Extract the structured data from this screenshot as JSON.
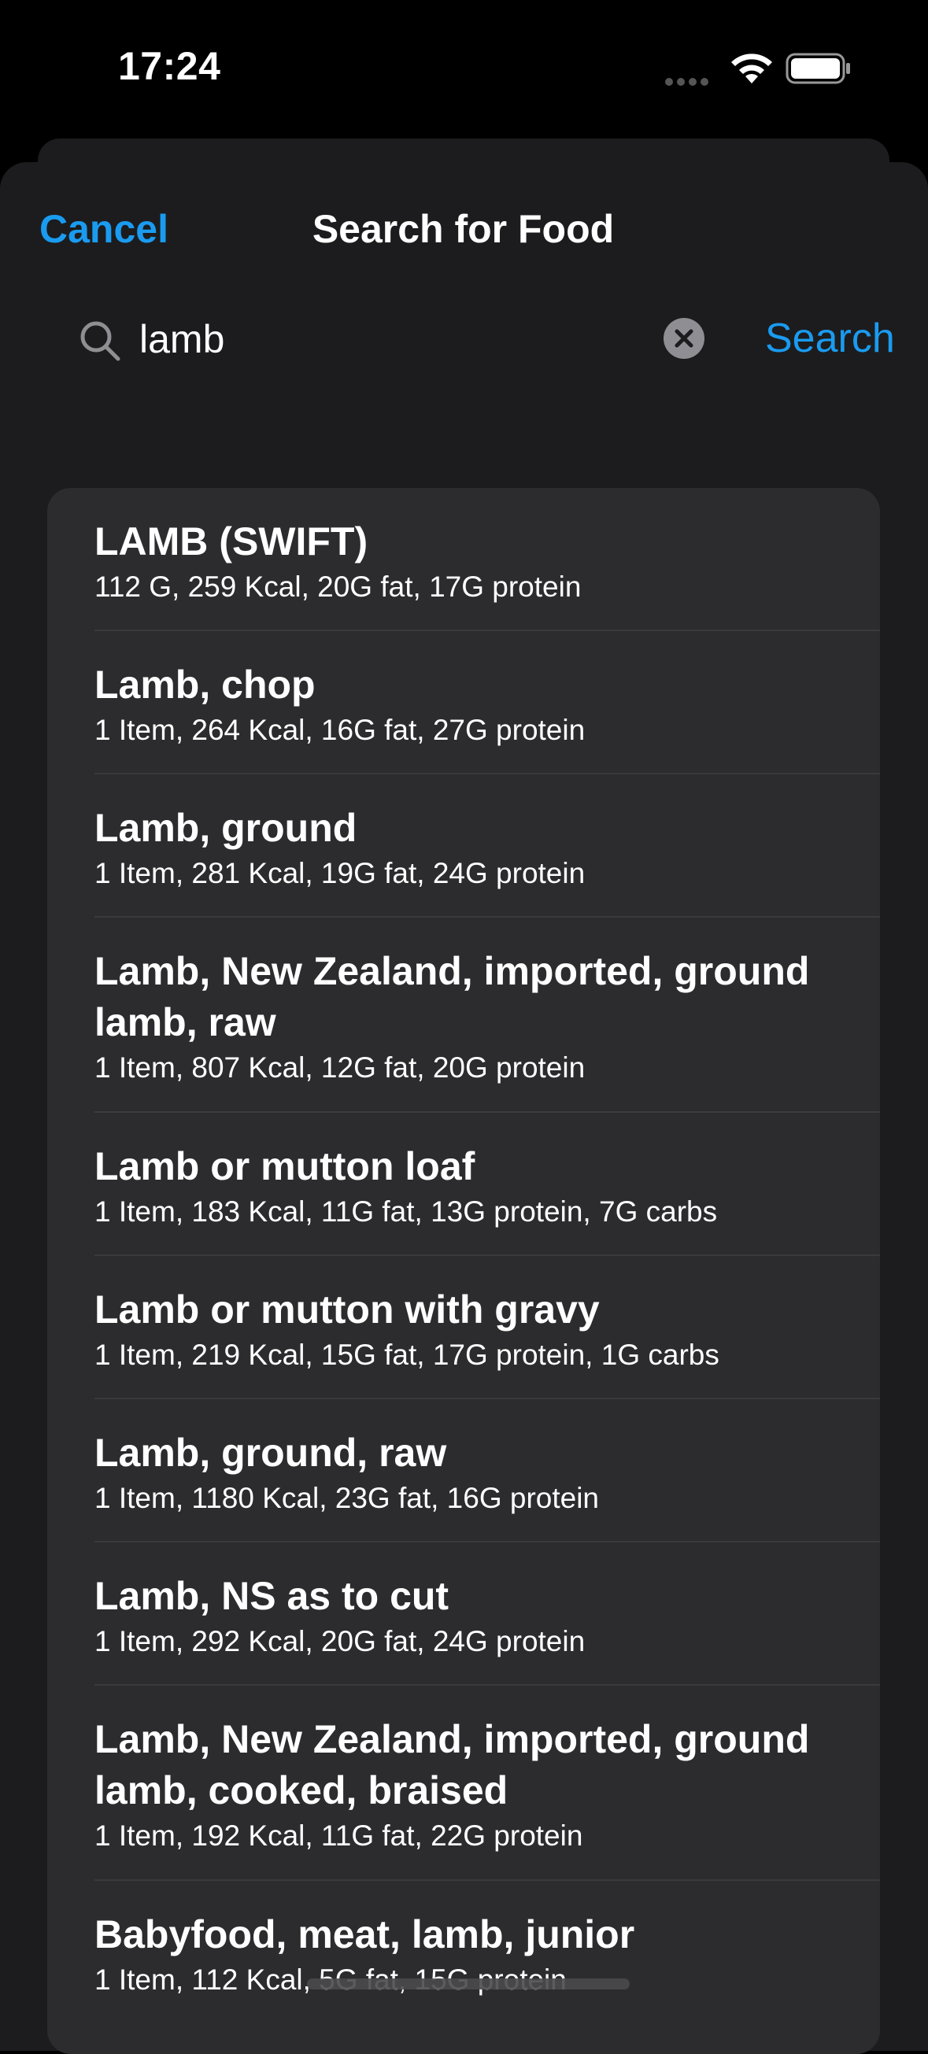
{
  "status_bar": {
    "time": "17:24"
  },
  "header": {
    "cancel_label": "Cancel",
    "title": "Search for Food"
  },
  "search": {
    "query": "lamb",
    "placeholder": "",
    "search_label": "Search"
  },
  "results": [
    {
      "name": "LAMB (SWIFT)",
      "desc": "112 G, 259 Kcal, 20G fat, 17G protein"
    },
    {
      "name": "Lamb, chop",
      "desc": "1 Item, 264 Kcal, 16G fat, 27G protein"
    },
    {
      "name": "Lamb, ground",
      "desc": "1 Item, 281 Kcal, 19G fat, 24G protein"
    },
    {
      "name": "Lamb, New Zealand, imported, ground lamb, raw",
      "desc": "1 Item, 807 Kcal, 12G fat, 20G protein"
    },
    {
      "name": "Lamb or mutton loaf",
      "desc": "1 Item, 183 Kcal, 11G fat, 13G protein, 7G carbs"
    },
    {
      "name": "Lamb or mutton with gravy",
      "desc": "1 Item, 219 Kcal, 15G fat, 17G protein, 1G carbs"
    },
    {
      "name": "Lamb, ground, raw",
      "desc": "1 Item, 1180 Kcal, 23G fat, 16G protein"
    },
    {
      "name": "Lamb, NS as to cut",
      "desc": "1 Item, 292 Kcal, 20G fat, 24G protein"
    },
    {
      "name": "Lamb, New Zealand, imported, ground lamb, cooked, braised",
      "desc": "1 Item, 192 Kcal, 11G fat, 22G protein"
    },
    {
      "name": "Babyfood, meat, lamb, junior",
      "desc": "1 Item, 112 Kcal, 5G fat, 15G protein"
    }
  ],
  "colors": {
    "accent": "#1a9bf0",
    "background": "#1c1c1e",
    "card": "#2c2c2e"
  }
}
